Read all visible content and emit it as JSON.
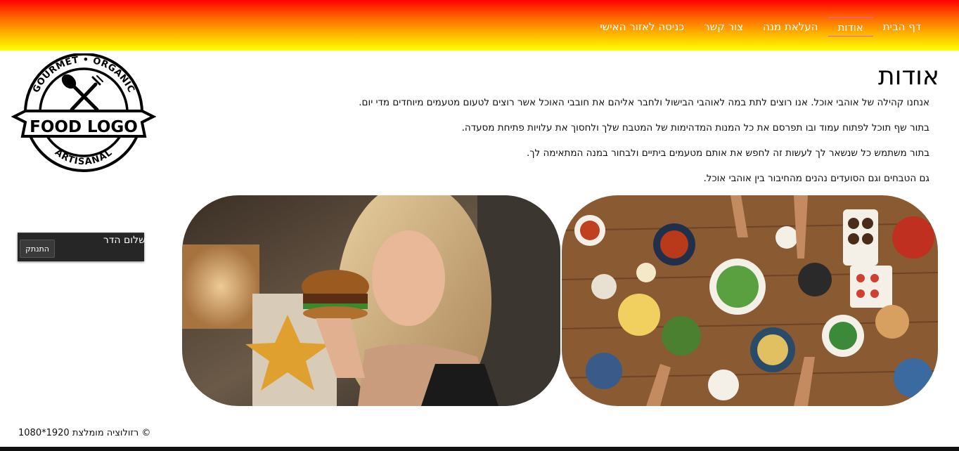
{
  "nav": {
    "items": [
      {
        "label": "דף הבית"
      },
      {
        "label": "אודות"
      },
      {
        "label": "העלאת מנה"
      },
      {
        "label": "צור קשר"
      },
      {
        "label": "כניסה לאזור האישי"
      }
    ],
    "active_index": 1
  },
  "logo": {
    "top_text": "GOURMET • ORGANIC",
    "main_text": "FOOD LOGO",
    "bottom_text": "ARTISANAL"
  },
  "about": {
    "title": "אודות",
    "paragraphs": [
      "אנחנו קהילה של אוהבי אוכל. אנו רוצים לתת במה לאוהבי הבישול ולחבר אליהם את חובבי האוכל אשר רוצים לטעום מטעמים מיוחדים מדי יום.",
      "בתור שף תוכל לפתוח עמוד ובו תפרסם את כל המנות המדהימות של המטבח שלך ולחסוך את עלויות פתיחת מסעדה.",
      "בתור משתמש כל שנשאר לך לעשות זה לחפש את אותם מטעמים ביתיים ולבחור במנה המתאימה לך.",
      "גם הטבחים וגם הסועדים נהנים מהחיבור בין אוהבי אוכל."
    ]
  },
  "user": {
    "greeting": "שלום הדר",
    "logout_label": "התנתק"
  },
  "footer": {
    "text": "© רזולוציה מומלצת 1920*1080"
  },
  "colors": {
    "nav_gradient_top": "#ff0000",
    "nav_gradient_bottom": "#ffff00",
    "active_underline": "#e85cc4",
    "user_box_bg": "#262626"
  }
}
